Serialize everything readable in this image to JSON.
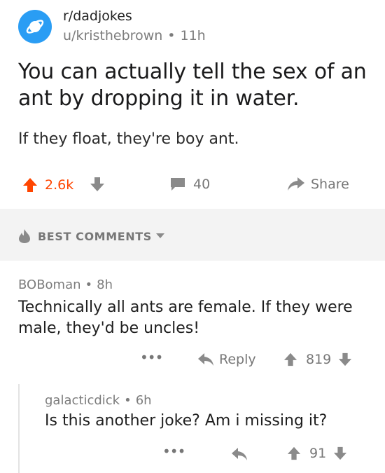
{
  "post": {
    "subreddit": "r/dadjokes",
    "author": "u/kristhebrown",
    "meta_separator": "•",
    "age": "11h",
    "title": "You can actually tell the sex of an ant by dropping it in water.",
    "body": "If they float, they're boy ant.",
    "score": "2.6k",
    "comment_count": "40",
    "share_label": "Share"
  },
  "comments_header": {
    "sort_label": "BEST COMMENTS"
  },
  "comments": [
    {
      "author": "BOBoman",
      "separator": "•",
      "age": "8h",
      "body": "Technically all ants are female. If they were male, they'd be uncles!",
      "more_label": "•••",
      "reply_label": "Reply",
      "score": "819"
    },
    {
      "author": "galacticdick",
      "separator": "•",
      "age": "6h",
      "body": "Is this another joke? Am i missing it?",
      "more_label": "•••",
      "score": "91"
    }
  ],
  "colors": {
    "upvote_active": "#ff4500",
    "subreddit_icon": "#2a9df4",
    "muted": "#777777",
    "separator_band": "#f3f3f3"
  },
  "icons": {
    "subreddit": "planet-icon",
    "upvote": "arrow-up-icon",
    "downvote": "arrow-down-icon",
    "comments": "comment-bubble-icon",
    "share": "share-arrow-icon",
    "best": "flame-icon",
    "sort_caret": "caret-down-icon",
    "reply": "reply-arrow-icon"
  }
}
